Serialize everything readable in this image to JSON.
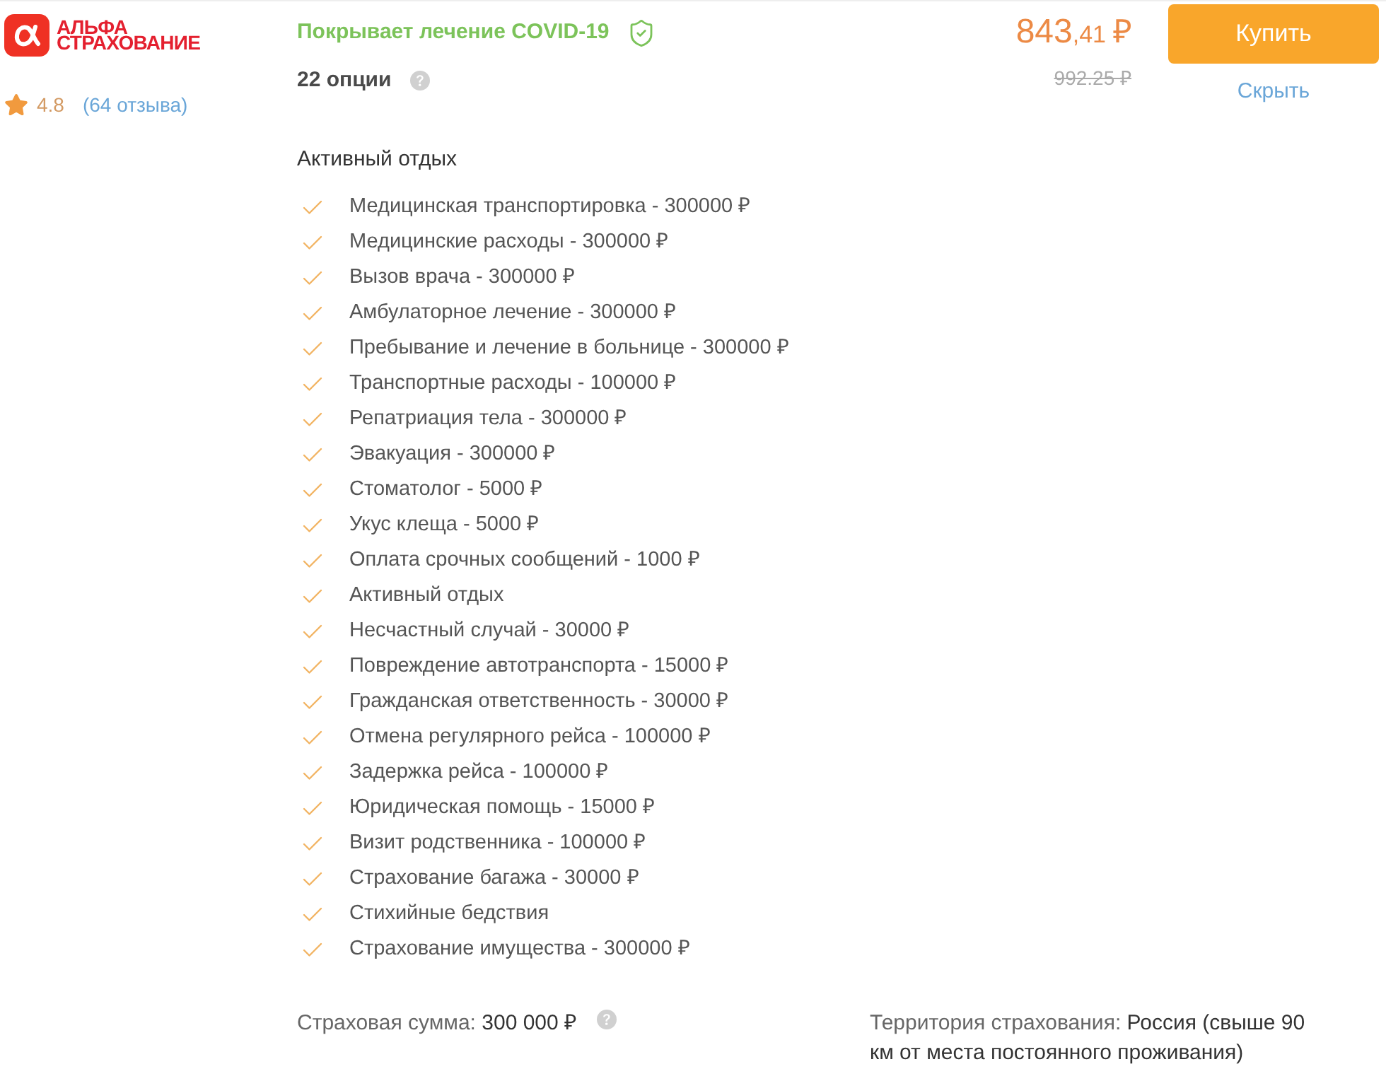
{
  "insurer": {
    "logo_lines": [
      "АЛЬФА",
      "СТРАХОВАНИЕ"
    ],
    "rating": "4.8",
    "reviews": "(64 отзыва)"
  },
  "coverage": {
    "text": "Покрывает лечение COVID-19"
  },
  "options_count": "22 опции",
  "price": {
    "integer": "843",
    "fraction": ",41",
    "currency": "₽",
    "old": "992.25 ₽"
  },
  "actions": {
    "buy": "Купить",
    "hide": "Скрыть"
  },
  "section": {
    "title": "Активный отдых",
    "options": [
      "Медицинская транспортировка - 300000 ₽",
      "Медицинские расходы - 300000 ₽",
      "Вызов врача - 300000 ₽",
      "Амбулаторное лечение - 300000 ₽",
      "Пребывание и лечение в больнице - 300000 ₽",
      "Транспортные расходы - 100000 ₽",
      "Репатриация тела - 300000 ₽",
      "Эвакуация - 300000 ₽",
      "Стоматолог - 5000 ₽",
      "Укус клеща - 5000 ₽",
      "Оплата срочных сообщений - 1000 ₽",
      "Активный отдых",
      "Несчастный случай - 30000 ₽",
      "Повреждение автотранспорта - 15000 ₽",
      "Гражданская ответственность - 30000 ₽",
      "Отмена регулярного рейса - 100000 ₽",
      "Задержка рейса - 100000 ₽",
      "Юридическая помощь - 15000 ₽",
      "Визит родственника - 100000 ₽",
      "Страхование багажа - 30000 ₽",
      "Стихийные бедствия",
      "Страхование имущества - 300000 ₽"
    ]
  },
  "summary": {
    "sum": {
      "label": "Страховая сумма:",
      "value": "300 000 ₽"
    },
    "territory": {
      "label": "Территория страхования:",
      "value": "Россия (свыше 90 км от места постоянного проживания)"
    }
  }
}
